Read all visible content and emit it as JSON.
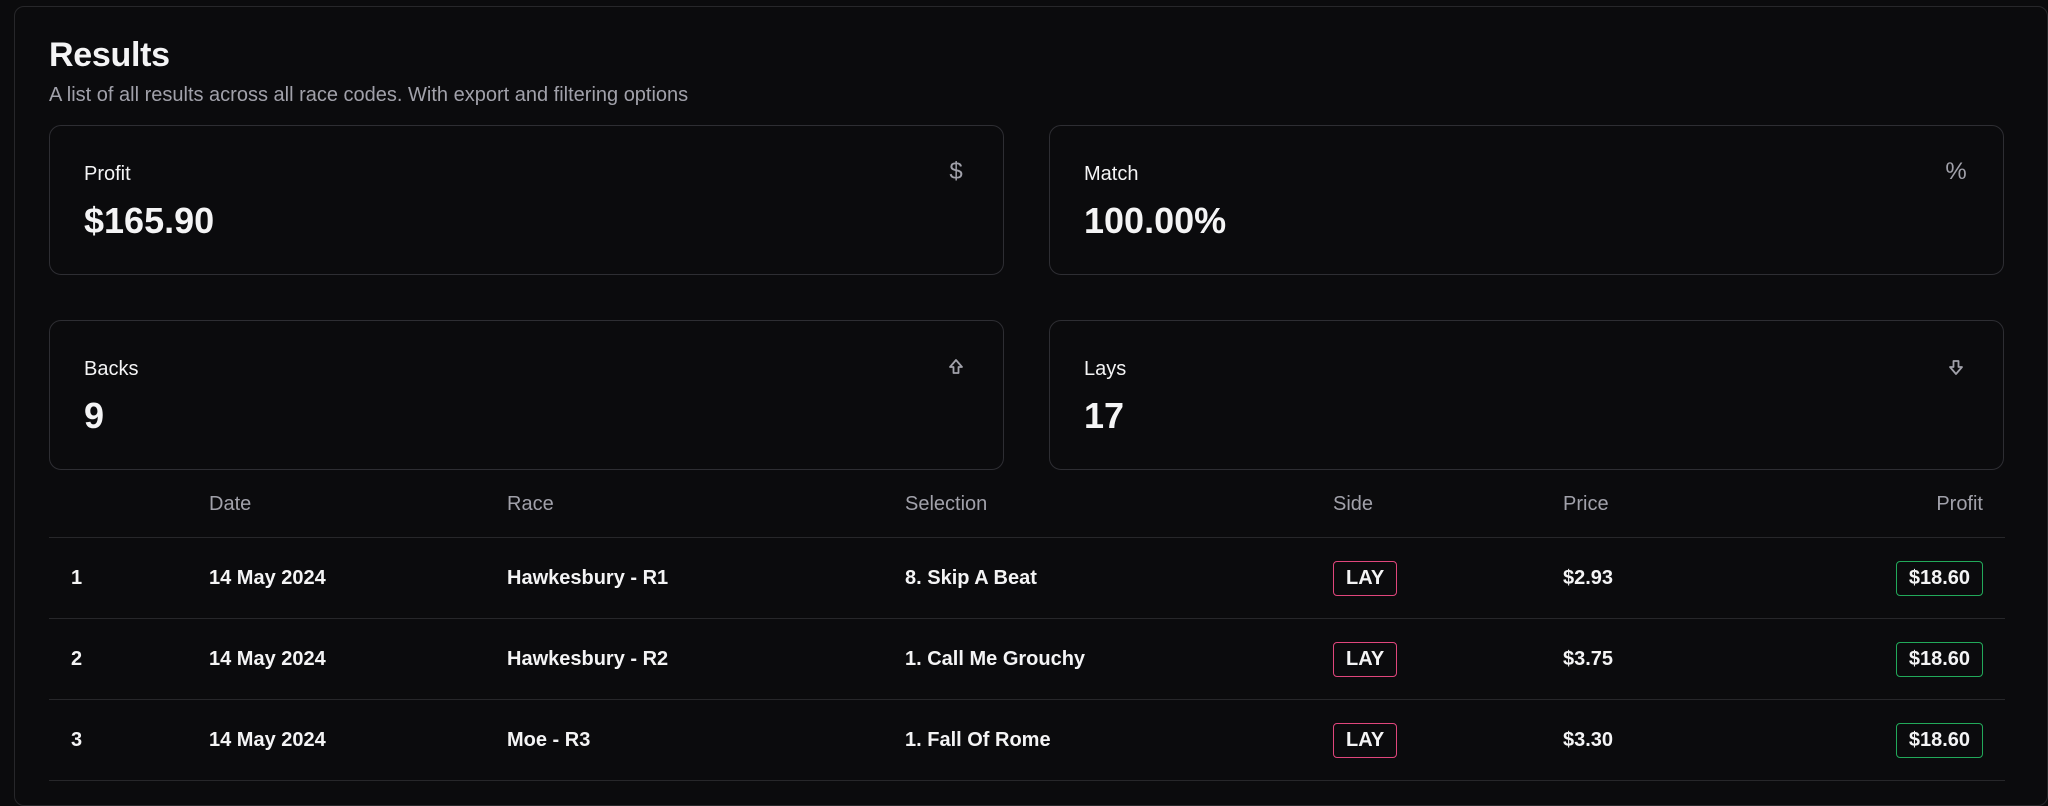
{
  "header": {
    "title": "Results",
    "subtitle": "A list of all results across all race codes. With export and filtering options"
  },
  "stats": [
    {
      "label": "Profit",
      "value": "$165.90",
      "icon": "dollar-icon",
      "icon_glyph": "$"
    },
    {
      "label": "Match",
      "value": "100.00%",
      "icon": "percent-icon",
      "icon_glyph": "%"
    },
    {
      "label": "Backs",
      "value": "9",
      "icon": "arrow-up-icon"
    },
    {
      "label": "Lays",
      "value": "17",
      "icon": "arrow-down-icon"
    }
  ],
  "table": {
    "columns": {
      "index": "",
      "date": "Date",
      "race": "Race",
      "selection": "Selection",
      "side": "Side",
      "price": "Price",
      "profit": "Profit"
    },
    "rows": [
      {
        "index": "1",
        "date": "14 May 2024",
        "race": "Hawkesbury - R1",
        "selection": "8. Skip A Beat",
        "side": "LAY",
        "price": "$2.93",
        "profit": "$18.60"
      },
      {
        "index": "2",
        "date": "14 May 2024",
        "race": "Hawkesbury - R2",
        "selection": "1. Call Me Grouchy",
        "side": "LAY",
        "price": "$3.75",
        "profit": "$18.60"
      },
      {
        "index": "3",
        "date": "14 May 2024",
        "race": "Moe - R3",
        "selection": "1. Fall Of Rome",
        "side": "LAY",
        "price": "$3.30",
        "profit": "$18.60"
      }
    ]
  },
  "colors": {
    "background": "#0b0b0d",
    "border": "#27272a",
    "lay_badge": "#e0467c",
    "profit_badge": "#22a95a",
    "muted_text": "#a1a1aa"
  }
}
